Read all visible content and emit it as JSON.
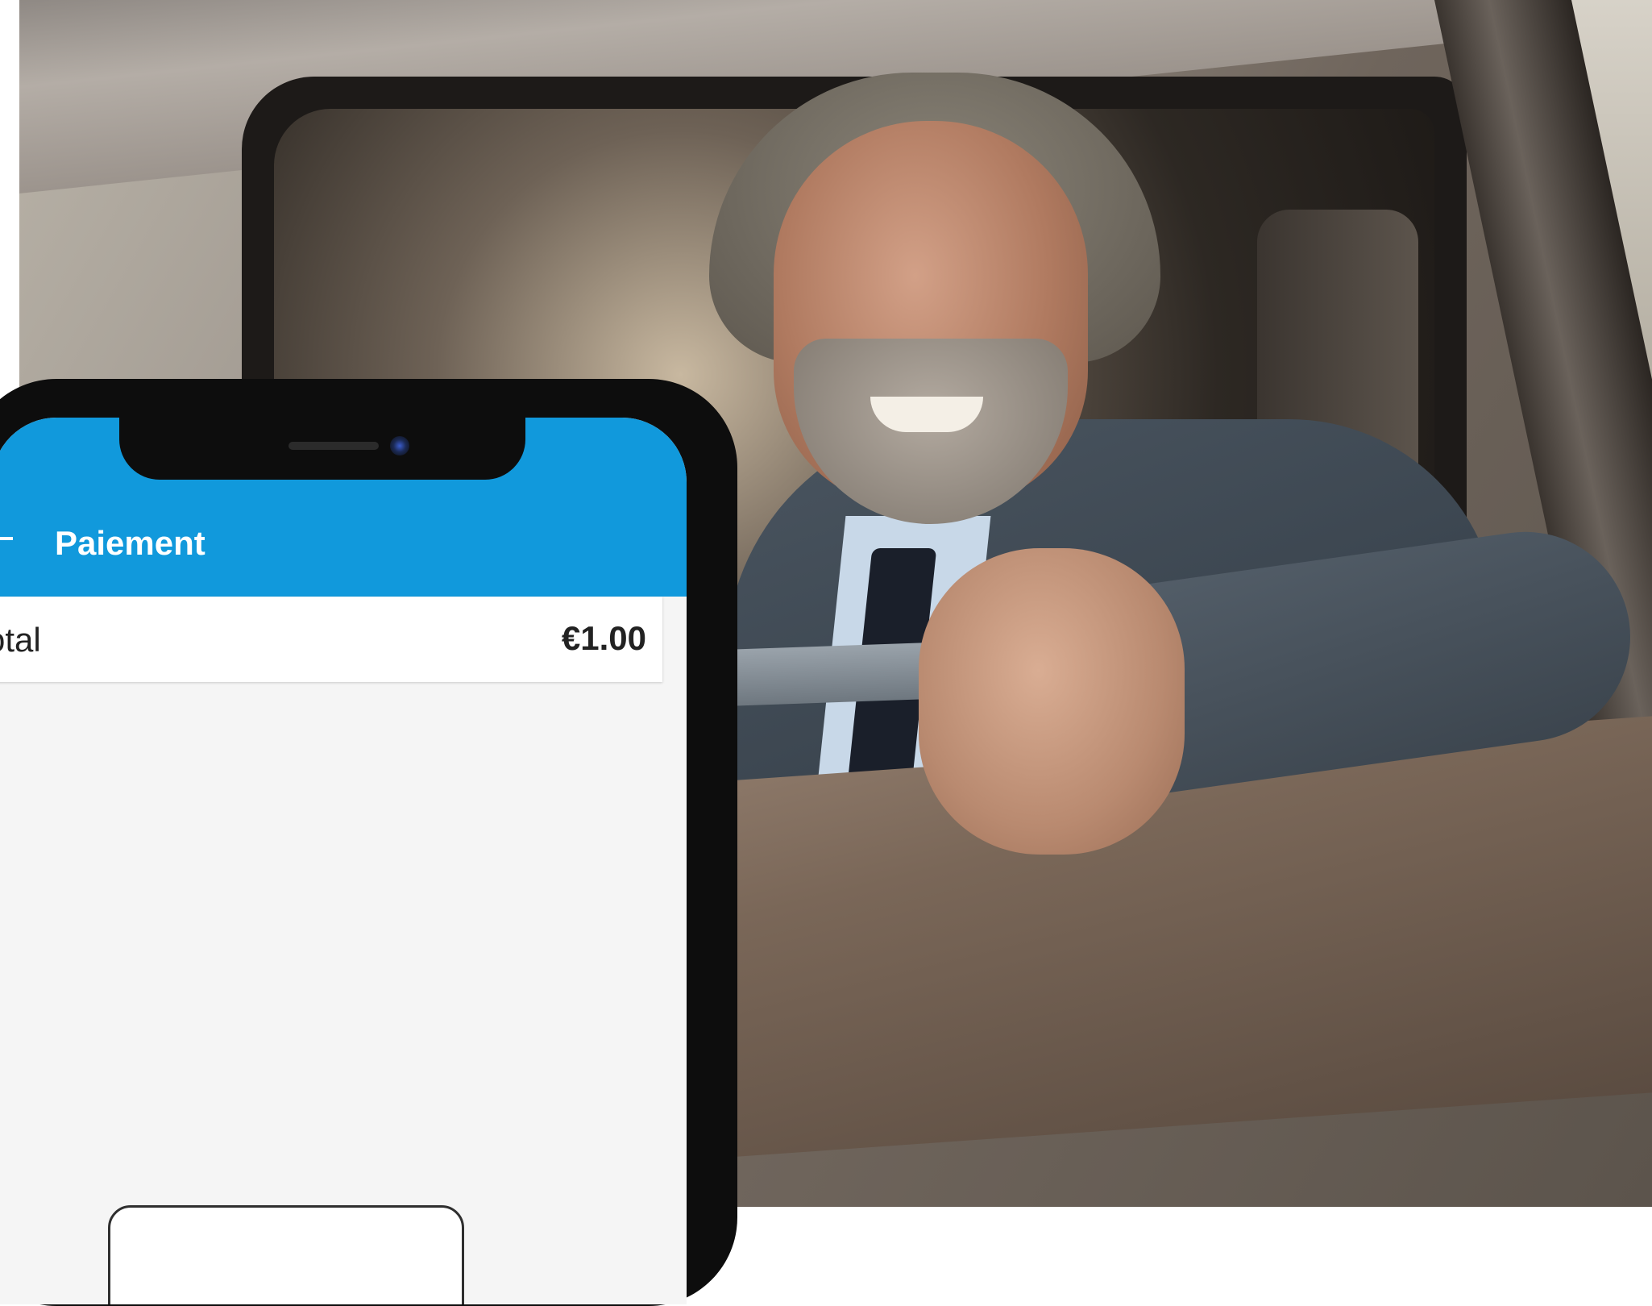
{
  "app": {
    "title": "Paiement"
  },
  "payment": {
    "total_label": "Total",
    "total_value": "€1.00"
  },
  "colors": {
    "app_bar": "#1199dc",
    "screen_background": "#f5f5f5",
    "phone_frame": "#0d0d0d"
  },
  "icons": {
    "back": "back-arrow-icon"
  }
}
